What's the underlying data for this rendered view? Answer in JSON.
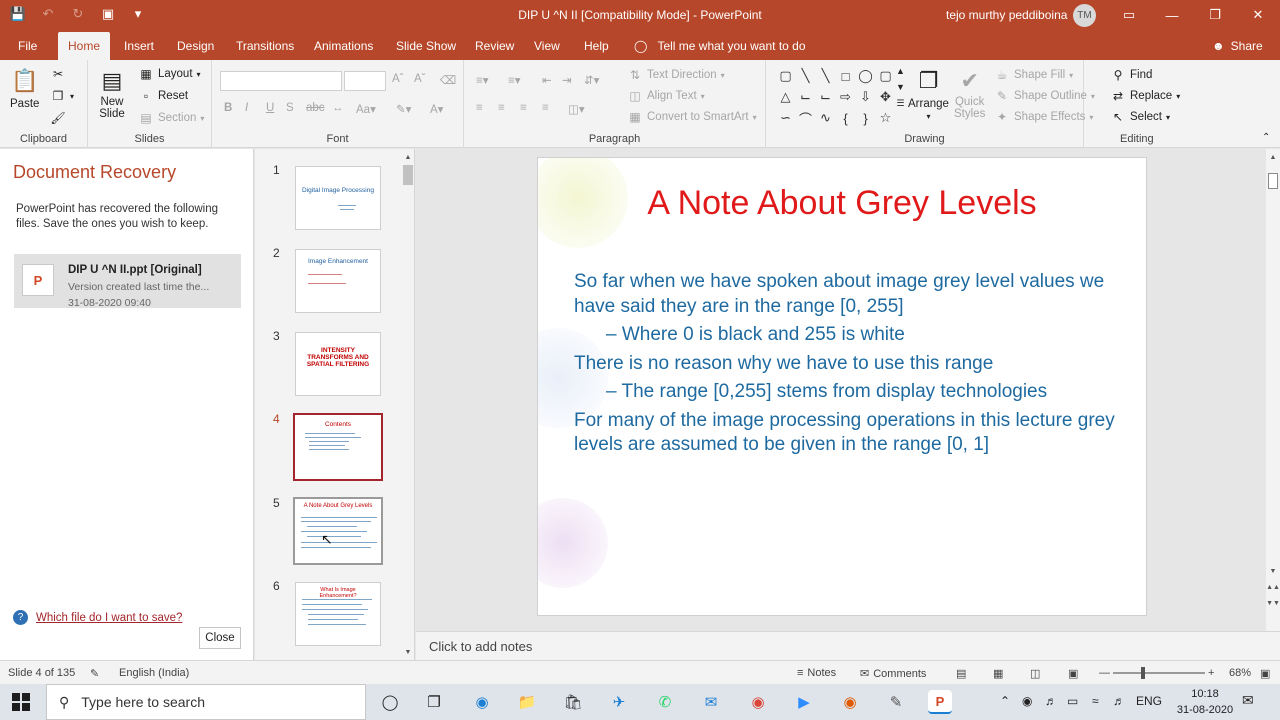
{
  "window": {
    "title": "DIP U ^N II [Compatibility Mode] - PowerPoint",
    "user_name": "tejo murthy peddiboina",
    "user_initials": "TM"
  },
  "tabs": [
    "File",
    "Home",
    "Insert",
    "Design",
    "Transitions",
    "Animations",
    "Slide Show",
    "Review",
    "View",
    "Help"
  ],
  "active_tab": "Home",
  "tell_me": "Tell me what you want to do",
  "share": "Share",
  "ribbon": {
    "clipboard": {
      "label": "Clipboard",
      "paste": "Paste"
    },
    "slides": {
      "label": "Slides",
      "new_slide": "New",
      "new_slide2": "Slide",
      "layout": "Layout",
      "reset": "Reset",
      "section": "Section"
    },
    "font": {
      "label": "Font"
    },
    "paragraph": {
      "label": "Paragraph",
      "text_direction": "Text Direction",
      "align_text": "Align Text",
      "convert_smartart": "Convert to SmartArt"
    },
    "drawing": {
      "label": "Drawing",
      "arrange": "Arrange",
      "quick_styles": "Quick",
      "quick_styles2": "Styles",
      "shape_fill": "Shape Fill",
      "shape_outline": "Shape Outline",
      "shape_effects": "Shape Effects"
    },
    "editing": {
      "label": "Editing",
      "find": "Find",
      "replace": "Replace",
      "select": "Select"
    }
  },
  "recovery": {
    "title": "Document Recovery",
    "description": "PowerPoint has recovered the following files.  Save the ones you wish to keep.",
    "file_name": "DIP U ^N II.ppt  [Original]",
    "file_sub": "Version created last time the...",
    "file_date": "31-08-2020 09:40",
    "help_link": "Which file do I want to save?",
    "close": "Close"
  },
  "thumbnails": [
    {
      "num": "1",
      "title": "Digital Image Processing"
    },
    {
      "num": "2",
      "title": "Image Enhancement"
    },
    {
      "num": "3",
      "title": "INTENSITY TRANSFORMS AND SPATIAL FILTERING"
    },
    {
      "num": "4",
      "title": "Contents"
    },
    {
      "num": "5",
      "title": "A Note About Grey Levels"
    },
    {
      "num": "6",
      "title": "What Is Image Enhancement?"
    }
  ],
  "slide": {
    "title": "A Note About Grey Levels",
    "p1": "So far when we have spoken about image grey level values we have said they are in the range [0, 255]",
    "p1_sub": "– Where 0 is black and 255 is white",
    "p2": "There is no reason why we have to use this range",
    "p2_sub": "– The range [0,255] stems from display technologies",
    "p3": "For many of the image processing operations in this lecture grey levels are assumed to  be given in the range [0, 1]"
  },
  "notes_placeholder": "Click to add notes",
  "status": {
    "slide_count": "Slide 4 of 135",
    "language": "English (India)",
    "notes": "Notes",
    "comments": "Comments",
    "zoom": "68%"
  },
  "taskbar": {
    "search_placeholder": "Type here to search",
    "lang": "ENG",
    "time": "10:18",
    "date": "31-08-2020"
  },
  "colors": {
    "accent": "#b7472a",
    "slide_title": "#e01a1a",
    "slide_body": "#1e6aa0"
  }
}
